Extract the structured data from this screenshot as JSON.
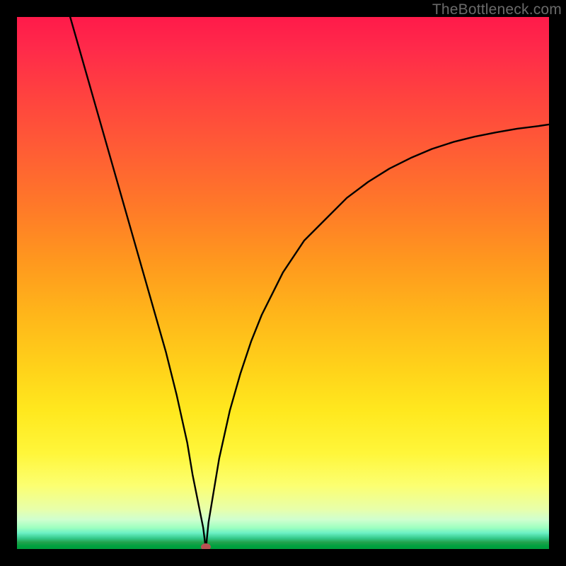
{
  "watermark": "TheBottleneck.com",
  "chart_data": {
    "type": "line",
    "title": "",
    "xlabel": "",
    "ylabel": "",
    "x_range": [
      0,
      100
    ],
    "y_range": [
      0,
      100
    ],
    "marker": {
      "x": 35.5,
      "y": 0
    },
    "series": [
      {
        "name": "curve",
        "x": [
          10,
          12,
          14,
          16,
          18,
          20,
          22,
          24,
          26,
          28,
          30,
          32,
          33,
          34,
          35,
          35.5,
          36,
          37,
          38,
          40,
          42,
          44,
          46,
          48,
          50,
          54,
          58,
          62,
          66,
          70,
          74,
          78,
          82,
          86,
          90,
          94,
          98,
          100
        ],
        "y": [
          100,
          93,
          86,
          79,
          72,
          65,
          58,
          51,
          44,
          37,
          29,
          20,
          14,
          9,
          4,
          0,
          5,
          11,
          17,
          26,
          33,
          39,
          44,
          48,
          52,
          58,
          62,
          66,
          69,
          71.5,
          73.5,
          75.2,
          76.5,
          77.5,
          78.3,
          79,
          79.5,
          79.8
        ]
      }
    ]
  }
}
